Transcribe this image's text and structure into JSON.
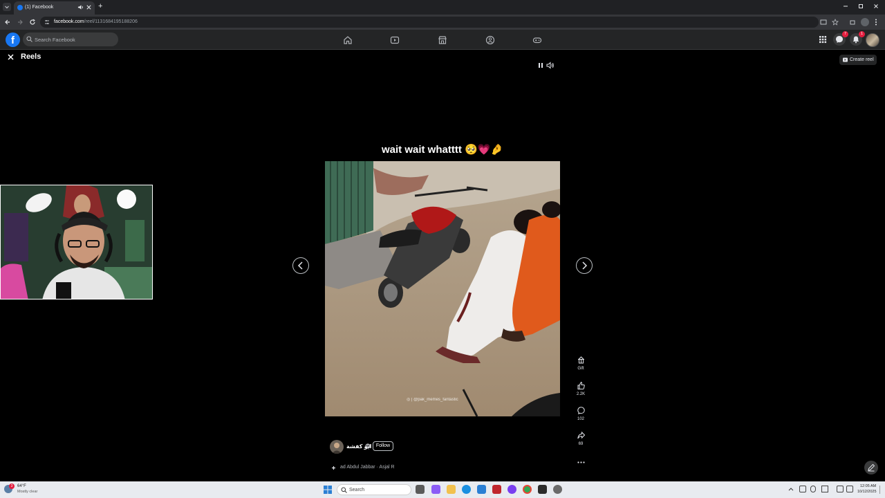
{
  "browser": {
    "tab_title": "(1) Facebook",
    "url_host": "facebook.com",
    "url_path": "/reel/1131684195188206",
    "new_tab": "+",
    "window_controls": [
      "minimize-icon",
      "restore-icon",
      "close-icon"
    ]
  },
  "header": {
    "logo": "f",
    "search_placeholder": "Search Facebook",
    "nav_icons": [
      "home-icon",
      "video-icon",
      "marketplace-icon",
      "groups-icon",
      "gaming-icon"
    ],
    "right_icons": [
      "menu-grid-icon",
      "messenger-icon",
      "notifications-icon",
      "profile-avatar"
    ],
    "messenger_badge": "7",
    "notifications_badge": "1"
  },
  "reels": {
    "title": "Reels",
    "close_icon": "close-icon",
    "create_label": "Create reel",
    "caption": "wait wait whatttt 🥺💗🤌",
    "watermark": "◎ | @pak_memes_fantastic",
    "prev_icon": "chevron-left-icon",
    "next_icon": "chevron-right-icon",
    "playback_icons": [
      "pause-icon",
      "volume-icon"
    ]
  },
  "actions": [
    {
      "icon": "gift-icon",
      "label": "Gift"
    },
    {
      "icon": "like-icon",
      "label": "2.2K"
    },
    {
      "icon": "comment-icon",
      "label": "102"
    },
    {
      "icon": "share-icon",
      "label": "69"
    }
  ],
  "more_icon": "more-icon",
  "author": {
    "name": "ابو كفشة",
    "follow_label": "Follow"
  },
  "audio": {
    "text": "ad Abdul Jabbar · Asjal R"
  },
  "taskbar": {
    "weather_temp": "64°F",
    "weather_desc": "Mostly clear",
    "weather_badge": "3",
    "search_placeholder": "Search",
    "time": "12:05 AM",
    "date": "10/12/2025"
  },
  "colors": {
    "fb_blue": "#1877f2",
    "header_bg": "#242526",
    "page_bg": "#000000",
    "badge_red": "#e41e3f",
    "taskbar_bg": "#e8ebf0"
  }
}
